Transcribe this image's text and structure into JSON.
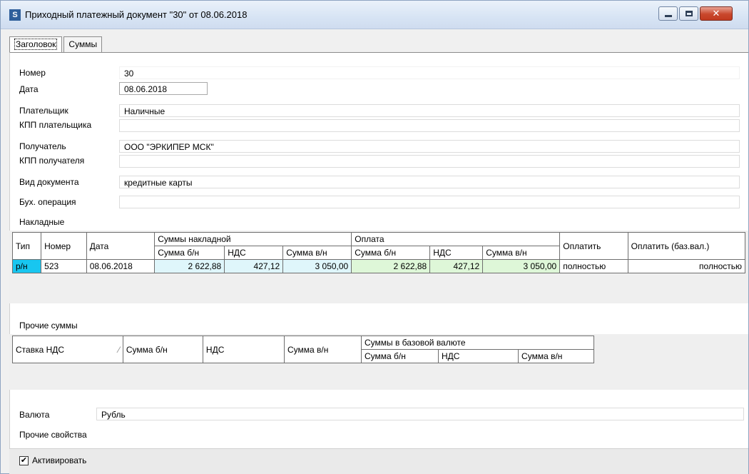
{
  "window": {
    "title": "Приходный платежный документ \"30\" от 08.06.2018",
    "close_glyph": "✕"
  },
  "tabs": [
    {
      "label": "Заголовок"
    },
    {
      "label": "Суммы"
    }
  ],
  "form": {
    "number": {
      "label": "Номер",
      "value": "30"
    },
    "date": {
      "label": "Дата",
      "value": "08.06.2018"
    },
    "payer": {
      "label": "Плательщик",
      "value": "Наличные"
    },
    "payer_kpp": {
      "label": "КПП плательщика",
      "value": ""
    },
    "recipient": {
      "label": "Получатель",
      "value": "ООО \"ЭРКИПЕР МСК\""
    },
    "recipient_kpp": {
      "label": "КПП получателя",
      "value": ""
    },
    "doc_type": {
      "label": "Вид документа",
      "value": "кредитные карты"
    },
    "accounting_op": {
      "label": "Бух. операция",
      "value": ""
    }
  },
  "invoices": {
    "section_label": "Накладные",
    "headers": {
      "type": "Тип",
      "number": "Номер",
      "date": "Дата",
      "invoice_sums": "Суммы накладной",
      "payment": "Оплата",
      "sum_no_vat": "Сумма б/н",
      "vat": "НДС",
      "sum_with_vat": "Сумма в/н",
      "pay": "Оплатить",
      "pay_base": "Оплатить (баз.вал.)"
    },
    "rows": [
      {
        "type": "р/н",
        "number": "523",
        "date": "08.06.2018",
        "inv_sum_no_vat": "2 622,88",
        "inv_vat": "427,12",
        "inv_sum_with_vat": "3 050,00",
        "pay_sum_no_vat": "2 622,88",
        "pay_vat": "427,12",
        "pay_sum_with_vat": "3 050,00",
        "pay": "полностью",
        "pay_base": "полностью"
      }
    ]
  },
  "other_sums": {
    "section_label": "Прочие суммы",
    "headers": {
      "vat_rate": "Ставка НДС",
      "sort_glyph": "⁄",
      "sum_no_vat": "Сумма б/н",
      "vat": "НДС",
      "sum_with_vat": "Сумма в/н",
      "base_currency": "Суммы в базовой валюте",
      "base_sum_no_vat": "Сумма б/н",
      "base_vat": "НДС",
      "base_sum_with_vat": "Сумма в/н"
    }
  },
  "currency": {
    "label": "Валюта",
    "value": "Рубль"
  },
  "other_props": {
    "label": "Прочие свойства"
  },
  "activate": {
    "label": "Активировать",
    "checked": true,
    "check_glyph": "✔"
  }
}
